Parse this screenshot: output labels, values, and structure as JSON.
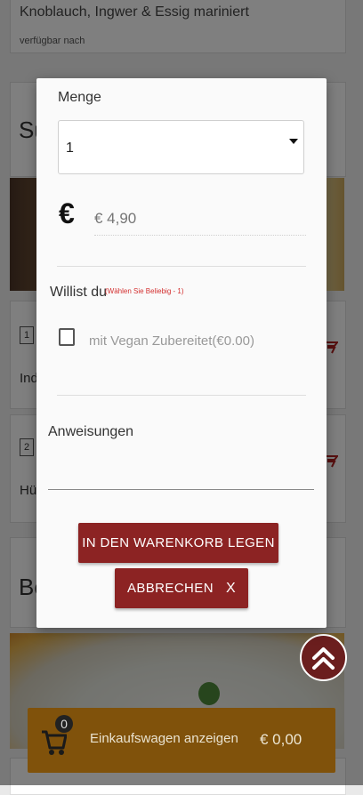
{
  "background": {
    "item_description": "Knoblauch, Ingwer & Essig mariniert",
    "availability": "verfügbar nach",
    "section1_partial": "Su",
    "item1_number": "1",
    "item1_partial": "Ind",
    "item2_number": "2",
    "item2_partial": "Hü",
    "section2_partial": "Be"
  },
  "modal": {
    "quantity_label": "Menge",
    "quantity_value": "1",
    "price_placeholder": "€ 4,90",
    "options_label": "Willist du",
    "options_hint": "(Wählen Sie Beliebig - 1)",
    "option_vegan": "mit Vegan Zubereitet(€0.00)",
    "instructions_label": "Anweisungen",
    "add_to_cart": "IN DEN WARENKORB LEGEN",
    "cancel": "ABBRECHEN",
    "cancel_icon_glyph": "X"
  },
  "cart": {
    "count": "0",
    "label": "Einkaufswagen anzeigen",
    "total": "€ 0,00",
    "icon": "cart-icon",
    "color": "#f59e16"
  },
  "colors": {
    "primary_button": "#8c2323",
    "hint_text": "#d32f2f",
    "scroll_top": "#6b1e1e"
  }
}
